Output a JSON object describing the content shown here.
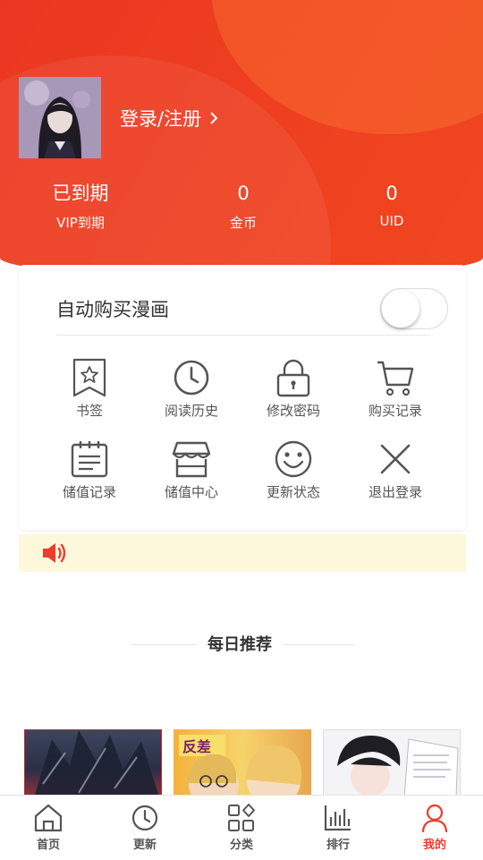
{
  "header": {
    "login_label": "登录/注册",
    "stats": [
      {
        "value": "已到期",
        "label": "VIP到期"
      },
      {
        "value": "0",
        "label": "金币"
      },
      {
        "value": "0",
        "label": "UID"
      }
    ]
  },
  "settings": {
    "auto_buy_label": "自动购买漫画",
    "auto_buy_enabled": false
  },
  "menu": [
    {
      "label": "书签",
      "icon": "bookmark-icon"
    },
    {
      "label": "阅读历史",
      "icon": "clock-icon"
    },
    {
      "label": "修改密码",
      "icon": "lock-icon"
    },
    {
      "label": "购买记录",
      "icon": "cart-icon"
    },
    {
      "label": "储值记录",
      "icon": "calendar-icon"
    },
    {
      "label": "储值中心",
      "icon": "store-icon"
    },
    {
      "label": "更新状态",
      "icon": "smile-icon"
    },
    {
      "label": "退出登录",
      "icon": "close-icon"
    }
  ],
  "notice": {
    "icon": "speaker-icon"
  },
  "recommend": {
    "title": "每日推荐"
  },
  "tabs": [
    {
      "label": "首页",
      "icon": "home-icon"
    },
    {
      "label": "更新",
      "icon": "clock-icon"
    },
    {
      "label": "分类",
      "icon": "category-icon"
    },
    {
      "label": "排行",
      "icon": "ranking-icon"
    },
    {
      "label": "我的",
      "icon": "user-icon",
      "active": true
    }
  ],
  "colors": {
    "brand": "#ec3a22",
    "active_tab": "#ef3b2a",
    "notice_bg": "#fdf7dc"
  }
}
